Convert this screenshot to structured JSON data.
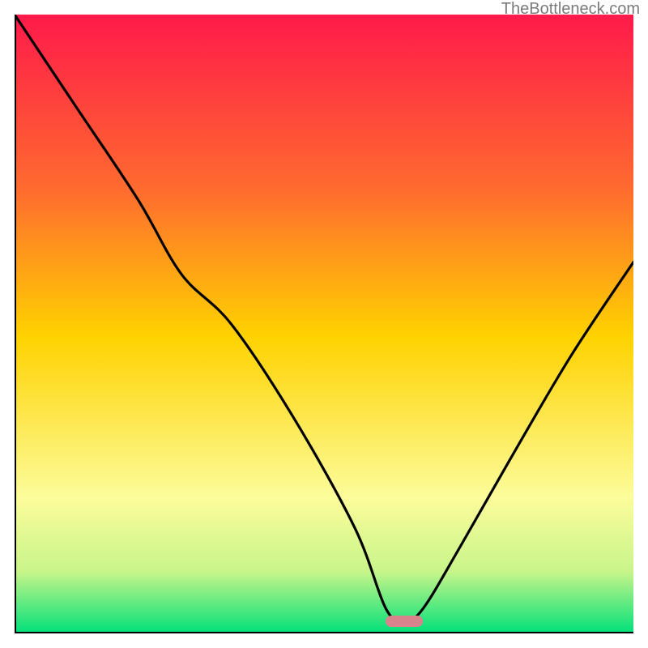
{
  "watermark": "TheBottleneck.com",
  "colors": {
    "gradient_top": "#ff1a4a",
    "gradient_mid_upper": "#ff8a2a",
    "gradient_mid": "#ffd500",
    "gradient_lower": "#fcfc9a",
    "gradient_bottom": "#00e07a",
    "curve": "#000000",
    "pill": "#d9838d",
    "axis": "#000000"
  },
  "chart_data": {
    "type": "line",
    "title": "",
    "xlabel": "",
    "ylabel": "",
    "xlim": [
      0,
      100
    ],
    "ylim": [
      0,
      100
    ],
    "optimum_x": 63,
    "marker": {
      "x_start": 60,
      "x_end": 66,
      "y": 2
    },
    "series": [
      {
        "name": "bottleneck-curve",
        "x": [
          0,
          10,
          20,
          27,
          35,
          45,
          55,
          60,
          63,
          66,
          72,
          80,
          90,
          100
        ],
        "y": [
          100,
          85,
          70,
          58,
          50,
          35,
          17,
          4,
          2,
          4,
          14,
          28,
          45,
          60
        ]
      }
    ],
    "background_gradient_stops": [
      {
        "pct": 0,
        "color": "#ff1a4a"
      },
      {
        "pct": 28,
        "color": "#ff6a2f"
      },
      {
        "pct": 52,
        "color": "#ffd200"
      },
      {
        "pct": 78,
        "color": "#fcfc9a"
      },
      {
        "pct": 90,
        "color": "#c8f58a"
      },
      {
        "pct": 100,
        "color": "#00e07a"
      }
    ]
  }
}
